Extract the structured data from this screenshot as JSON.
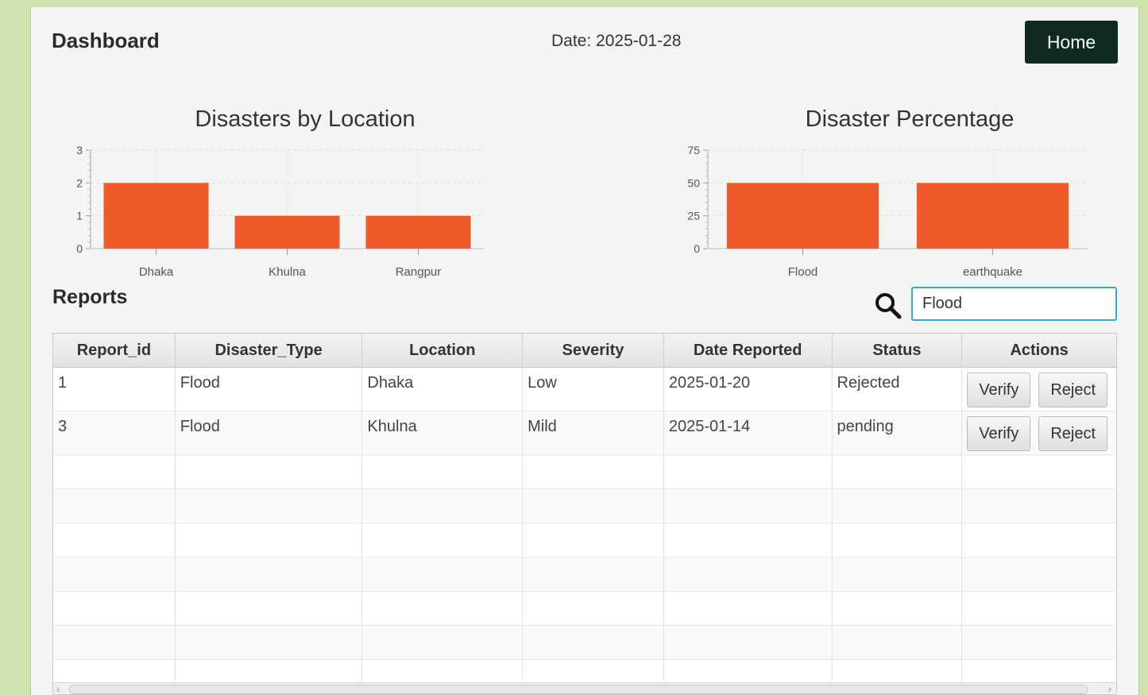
{
  "header": {
    "title": "Dashboard",
    "date": "Date: 2025-01-28",
    "home_label": "Home"
  },
  "colors": {
    "bar": "#ee5a2a",
    "home_bg": "#0f2b20",
    "search_border": "#3aa5d8"
  },
  "chart_data": [
    {
      "type": "bar",
      "title": "Disasters by Location",
      "categories": [
        "Dhaka",
        "Khulna",
        "Rangpur"
      ],
      "values": [
        2,
        1,
        1
      ],
      "ylim": [
        0,
        3
      ],
      "yticks": [
        0,
        1,
        2,
        3
      ],
      "grid": true
    },
    {
      "type": "bar",
      "title": "Disaster Percentage",
      "categories": [
        "Flood",
        "earthquake"
      ],
      "values": [
        50,
        50
      ],
      "ylim": [
        0,
        75
      ],
      "yticks": [
        0,
        25,
        50,
        75
      ],
      "grid": true
    }
  ],
  "reports": {
    "title": "Reports",
    "search_value": "Flood",
    "search_icon": "search-icon",
    "columns": [
      "Report_id",
      "Disaster_Type",
      "Location",
      "Severity",
      "Date Reported",
      "Status",
      "Actions"
    ],
    "rows": [
      {
        "id": "1",
        "type": "Flood",
        "location": "Dhaka",
        "severity": "Low",
        "date": "2025-01-20",
        "status": "Rejected",
        "verify": "Verify",
        "reject": "Reject"
      },
      {
        "id": "3",
        "type": "Flood",
        "location": "Khulna",
        "severity": "Mild",
        "date": "2025-01-14",
        "status": "pending",
        "verify": "Verify",
        "reject": "Reject"
      }
    ]
  }
}
